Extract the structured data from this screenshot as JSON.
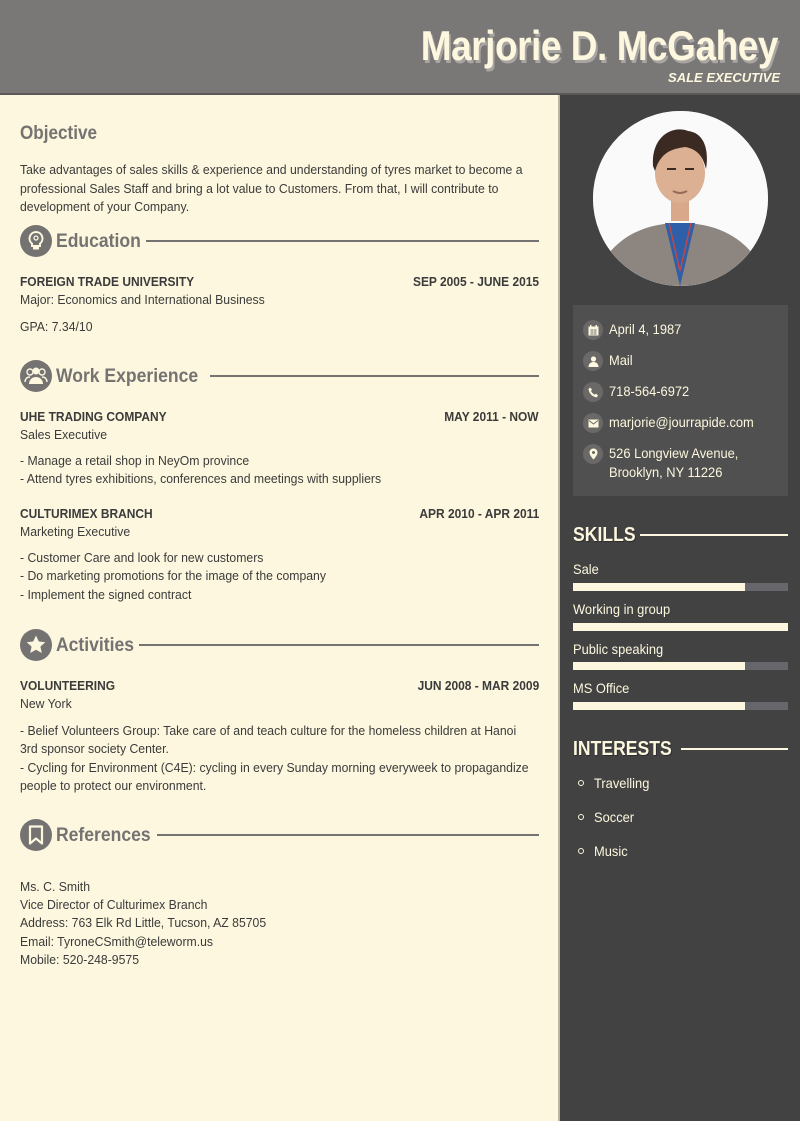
{
  "header": {
    "name": "Marjorie D. McGahey",
    "role": "SALE EXECUTIVE"
  },
  "objective": {
    "title": "Objective",
    "lines": [
      "Take advantages of sales skills & experience and understanding of tyres market to become a",
      "professional Sales Staff and bring a lot value to Customers. From that, I will contribute to",
      "development of your Company."
    ]
  },
  "education": {
    "title": "Education",
    "icon": "lightbulb-icon",
    "items": [
      {
        "org": "FOREIGN TRADE UNIVERSITY",
        "date": "SEP 2005 - JUNE 2015",
        "subtitle": "Major: Economics and International Business",
        "details": [
          "GPA: 7.34/10"
        ]
      }
    ]
  },
  "work": {
    "title": "Work Experience",
    "icon": "group-icon",
    "items": [
      {
        "org": "UHE TRADING COMPANY",
        "date": "MAY 2011 - NOW",
        "subtitle": "Sales Executive",
        "details": [
          "- Manage a retail shop in NeyOm province",
          "- Attend tyres exhibitions, conferences and meetings with suppliers"
        ]
      },
      {
        "org": "CULTURIMEX BRANCH",
        "date": "APR 2010 - APR 2011",
        "subtitle": "Marketing Executive",
        "details": [
          "- Customer Care and look for new customers",
          "- Do marketing promotions for the image of the company",
          "- Implement the signed contract"
        ]
      }
    ]
  },
  "activities": {
    "title": "Activities",
    "icon": "star-icon",
    "items": [
      {
        "org": "VOLUNTEERING",
        "date": "JUN 2008 - MAR 2009",
        "subtitle": "New York",
        "details": [
          "- Belief Volunteers Group: Take care of and teach culture for the homeless children at Hanoi",
          "3rd sponsor society Center.",
          "- Cycling for Environment (C4E): cycling in every Sunday morning everyweek to propagandize",
          "people to protect our environment."
        ]
      }
    ]
  },
  "references": {
    "title": "References",
    "icon": "bookmark-icon",
    "lines": [
      "Ms. C. Smith",
      "Vice Director of Culturimex Branch",
      "Address: 763 Elk Rd Little, Tucson, AZ 85705",
      "Email: TyroneCSmith@teleworm.us",
      "Mobile: 520-248-9575"
    ]
  },
  "contact": [
    {
      "icon": "calendar-icon",
      "text": "April 4, 1987"
    },
    {
      "icon": "user-icon",
      "text": "Mail"
    },
    {
      "icon": "phone-icon",
      "text": "718-564-6972"
    },
    {
      "icon": "envelope-icon",
      "text": "marjorie@jourrapide.com"
    },
    {
      "icon": "map-pin-icon",
      "text": "526 Longview Avenue,",
      "text2": "Brooklyn, NY 11226"
    }
  ],
  "skills": {
    "title": "SKILLS",
    "items": [
      {
        "label": "Sale",
        "level": 0.8
      },
      {
        "label": "Working in group",
        "level": 1.0
      },
      {
        "label": "Public speaking",
        "level": 0.8
      },
      {
        "label": "MS Office",
        "level": 0.8
      }
    ]
  },
  "interests": {
    "title": "INTERESTS",
    "items": [
      "Travelling",
      "Soccer",
      "Music"
    ]
  },
  "colors": {
    "cream": "#fcf7de",
    "dark": "#424242",
    "header": "#7a7777",
    "accent_gray": "#757272",
    "text": "#3b3b3b"
  }
}
